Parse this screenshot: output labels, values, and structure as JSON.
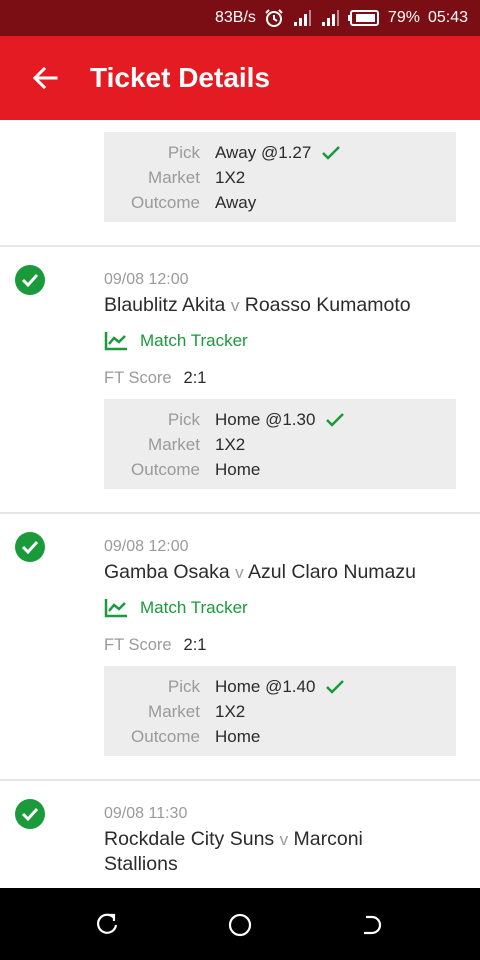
{
  "status_bar": {
    "speed": "83B/s",
    "battery": "79%",
    "time": "05:43",
    "icons": [
      "alarm-icon",
      "signal-icon",
      "signal-icon",
      "battery-icon"
    ]
  },
  "header": {
    "title": "Ticket Details",
    "back_icon": "arrow-left-icon"
  },
  "pick_labels": {
    "pick": "Pick",
    "market": "Market",
    "outcome": "Outcome"
  },
  "ft_label": "FT Score",
  "tracker_label": "Match Tracker",
  "first_pick": {
    "pick": "Away @1.27",
    "market": "1X2",
    "outcome": "Away"
  },
  "events": [
    {
      "date": "09/08 12:00",
      "home": "Blaublitz Akita",
      "vs": "v",
      "away": "Roasso Kumamoto",
      "ft_score": "2:1",
      "pick": "Home @1.30",
      "market": "1X2",
      "outcome": "Home"
    },
    {
      "date": "09/08 12:00",
      "home": "Gamba Osaka",
      "vs": "v",
      "away": "Azul Claro Numazu",
      "ft_score": "2:1",
      "pick": "Home @1.40",
      "market": "1X2",
      "outcome": "Home"
    },
    {
      "date": "09/08 11:30",
      "home": "Rockdale City Suns",
      "vs": "v",
      "away": "Marconi Stallions"
    }
  ],
  "colors": {
    "status_bar": "#7a0e14",
    "app_bar": "#e41b23",
    "green": "#1a9a3a",
    "pick_bg": "#ededed"
  },
  "nav_icons": [
    "recent-apps-icon",
    "home-icon",
    "back-icon"
  ]
}
